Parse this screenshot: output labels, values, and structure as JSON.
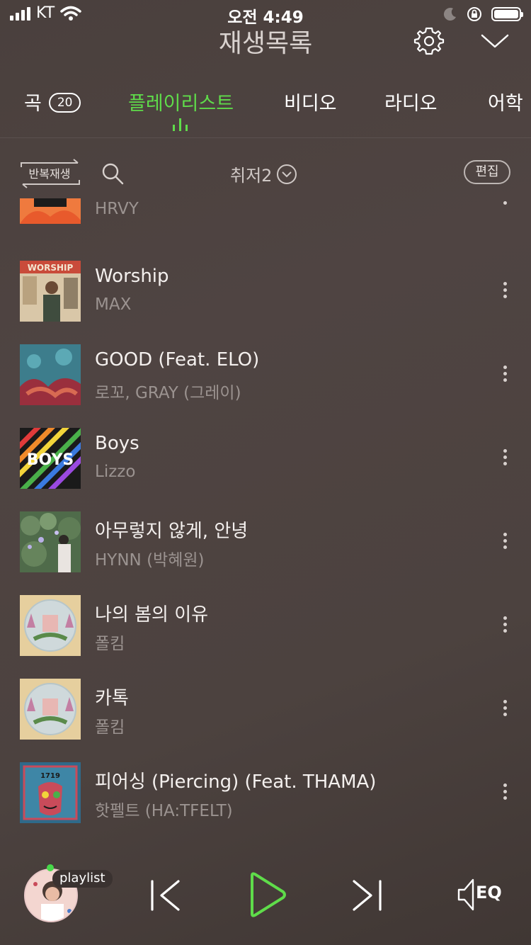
{
  "status_bar": {
    "carrier": "KT",
    "time": "오전 4:49"
  },
  "header": {
    "title": "재생목록"
  },
  "tabs": [
    {
      "label": "곡",
      "count": "20"
    },
    {
      "label": "플레이리스트"
    },
    {
      "label": "비디오"
    },
    {
      "label": "라디오"
    },
    {
      "label": "어학"
    }
  ],
  "toolbar": {
    "repeat_label": "반복재생",
    "sort_label": "취저2",
    "edit_label": "편집"
  },
  "songs": [
    {
      "title": "",
      "artist": "HRVY"
    },
    {
      "title": "Worship",
      "artist": "MAX"
    },
    {
      "title": "GOOD (Feat. ELO)",
      "artist": "로꼬, GRAY (그레이)"
    },
    {
      "title": "Boys",
      "artist": "Lizzo"
    },
    {
      "title": "아무렇지 않게, 안녕",
      "artist": "HYNN (박혜원)"
    },
    {
      "title": "나의 봄의 이유",
      "artist": "폴킴"
    },
    {
      "title": "카톡",
      "artist": "폴킴"
    },
    {
      "title": "피어싱 (Piercing) (Feat. THAMA)",
      "artist": "핫펠트 (HA:TFELT)"
    }
  ],
  "album_texts": {
    "worship": "WORSHIP",
    "boys": "BOYS",
    "year": "1719"
  },
  "player": {
    "playlist_badge": "playlist",
    "eq_label": "EQ"
  },
  "colors": {
    "accent": "#5fdc4a",
    "background": "#4c423f"
  }
}
